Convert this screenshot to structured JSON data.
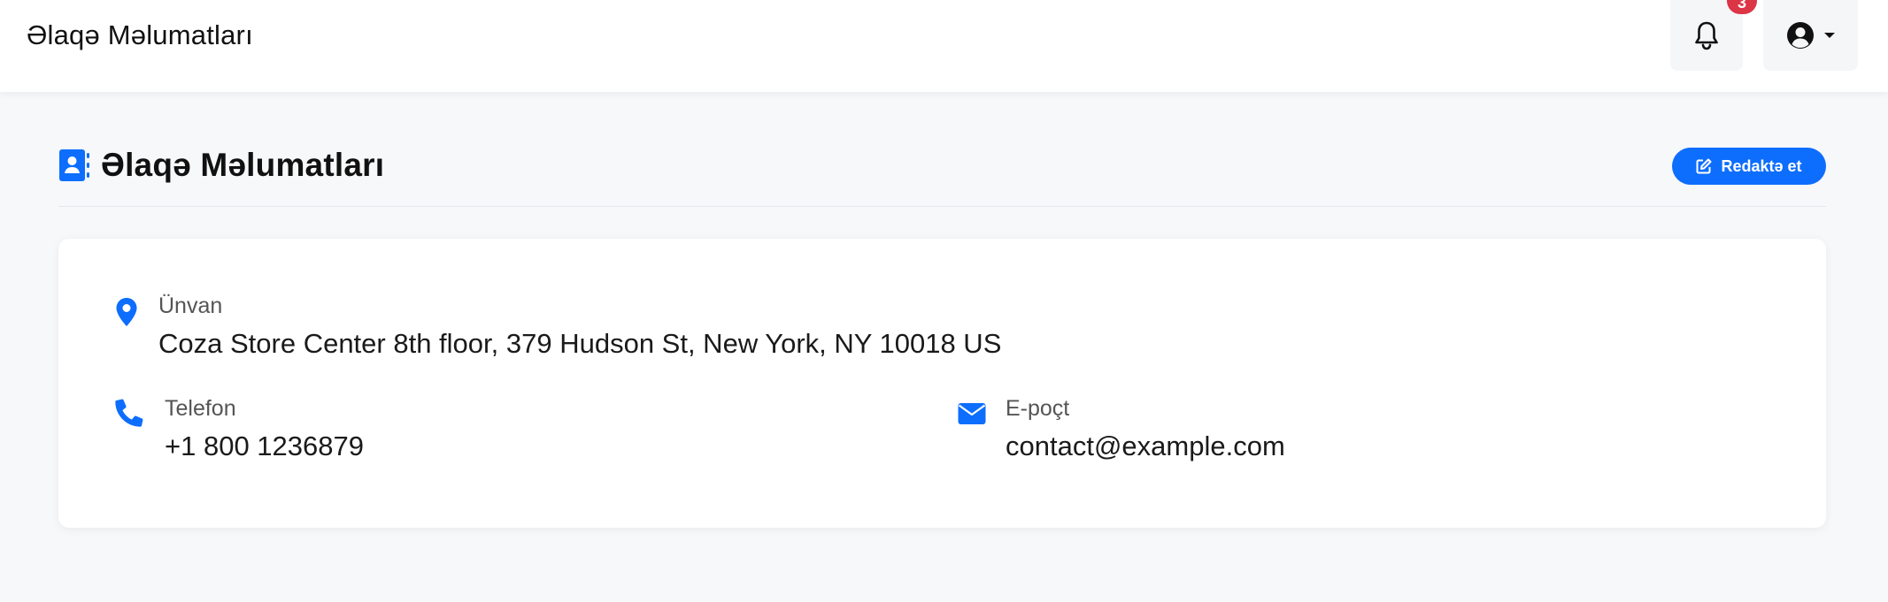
{
  "topbar": {
    "title": "Əlaqə Məlumatları",
    "notifications": {
      "count": "3",
      "icon": "bell-icon"
    },
    "user_menu": {
      "icon": "user-circle-icon",
      "caret": "caret-down-icon"
    }
  },
  "page": {
    "title": "Əlaqə Məlumatları",
    "title_icon": "address-book-icon",
    "edit_button": {
      "label": "Redaktə et",
      "icon": "edit-icon"
    }
  },
  "contact": {
    "address": {
      "label": "Ünvan",
      "value": "Coza Store Center 8th floor, 379 Hudson St, New York, NY 10018 US",
      "icon": "map-marker-icon"
    },
    "phone": {
      "label": "Telefon",
      "value": "+1 800 1236879",
      "icon": "phone-icon"
    },
    "email": {
      "label": "E-poçt",
      "value": "contact@example.com",
      "icon": "envelope-icon"
    }
  },
  "colors": {
    "accent": "#0d6efd",
    "badge": "#dc3545",
    "background": "#f7f8fa"
  }
}
